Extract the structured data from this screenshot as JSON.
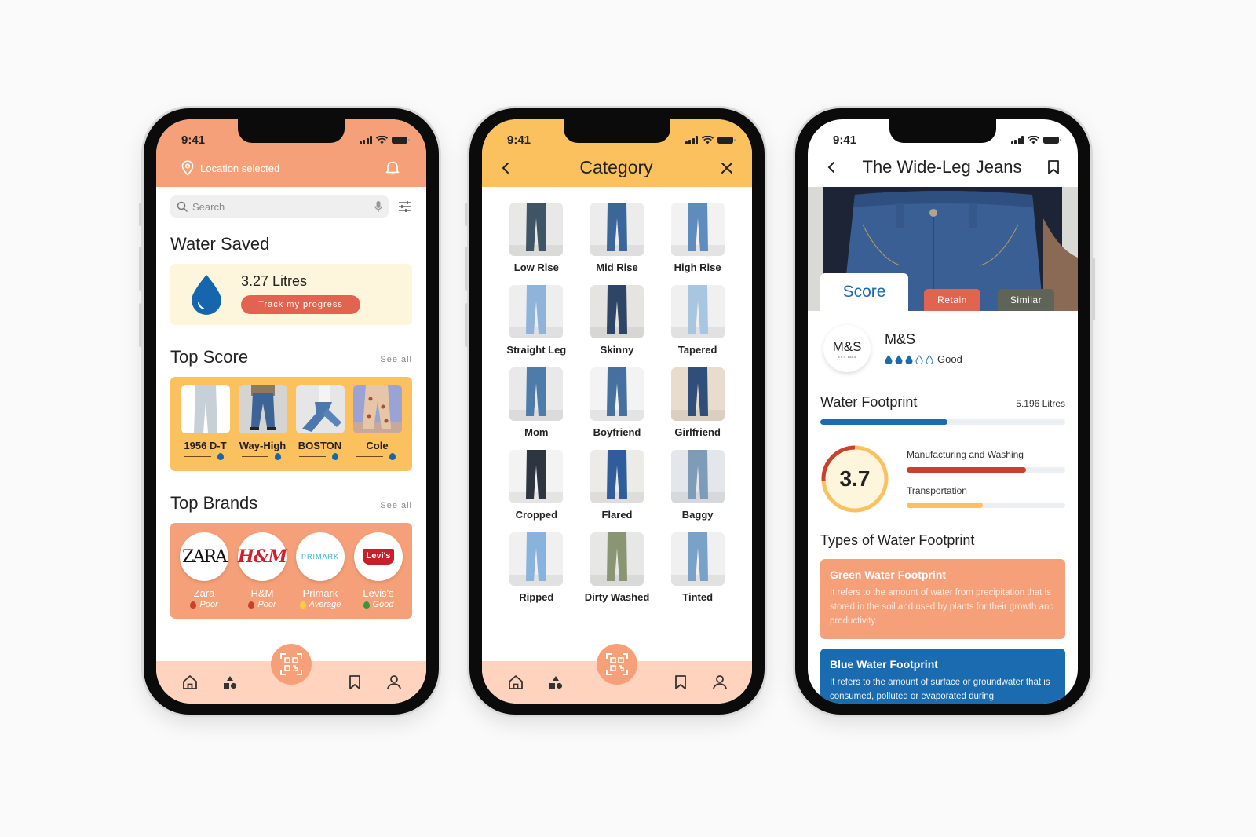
{
  "status_bar": {
    "time": "9:41"
  },
  "colors": {
    "orange": "#f5a078",
    "peach": "#ffd3bd",
    "yellow": "#fbc15e",
    "cream": "#fdf5dc",
    "red": "#e2634f",
    "blue": "#1a6bb0",
    "dark_red": "#c9402b",
    "olive": "#5f6459"
  },
  "home": {
    "location_label": "Location selected",
    "search_placeholder": "Search",
    "water_saved": {
      "title": "Water Saved",
      "amount": "3.27 Litres",
      "button": "Track my progress"
    },
    "top_score": {
      "title": "Top Score",
      "see_all": "See all",
      "items": [
        {
          "name": "1956 D-T"
        },
        {
          "name": "Way-High"
        },
        {
          "name": "BOSTON"
        },
        {
          "name": "Cole"
        }
      ]
    },
    "top_brands": {
      "title": "Top Brands",
      "see_all": "See all",
      "items": [
        {
          "logo": "ZARA",
          "name": "Zara",
          "rating": "Poor",
          "rating_color": "#c9402b"
        },
        {
          "logo": "H&M",
          "name": "H&M",
          "rating": "Poor",
          "rating_color": "#c9402b"
        },
        {
          "logo": "PRIMARK",
          "name": "Primark",
          "rating": "Average",
          "rating_color": "#f5d03c"
        },
        {
          "logo": "Levi's",
          "name": "Levis's",
          "rating": "Good",
          "rating_color": "#2f9a3a"
        }
      ]
    }
  },
  "category": {
    "title": "Category",
    "items": [
      {
        "label": "Low Rise"
      },
      {
        "label": "Mid Rise"
      },
      {
        "label": "High Rise"
      },
      {
        "label": "Straight Leg"
      },
      {
        "label": "Skinny"
      },
      {
        "label": "Tapered"
      },
      {
        "label": "Mom"
      },
      {
        "label": "Boyfriend"
      },
      {
        "label": "Girlfriend"
      },
      {
        "label": "Cropped"
      },
      {
        "label": "Flared"
      },
      {
        "label": "Baggy"
      },
      {
        "label": "Ripped"
      },
      {
        "label": "Dirty Washed"
      },
      {
        "label": "Tinted"
      }
    ]
  },
  "detail": {
    "title": "The Wide-Leg Jeans",
    "tabs": {
      "score": "Score",
      "retain": "Retain",
      "similar": "Similar"
    },
    "brand": {
      "logo": "M&S",
      "logo_sub": "EST. 1884",
      "name": "M&S",
      "rating_label": "Good",
      "rating_filled": 3,
      "rating_max": 5
    },
    "water_footprint": {
      "title": "Water Footprint",
      "value": "5.196 Litres",
      "progress": 0.52
    },
    "score": {
      "value": "3.7",
      "breakdown": [
        {
          "label": "Manufacturing and Washing",
          "progress": 0.75,
          "color": "#c9402b"
        },
        {
          "label": "Transportation",
          "progress": 0.48,
          "color": "#fbc15e"
        }
      ]
    },
    "types": {
      "title": "Types of Water Footprint",
      "cards": [
        {
          "title": "Green Water Footprint",
          "text": "It refers to the amount of water from precipitation that is stored in the soil and used by plants for their growth and productivity."
        },
        {
          "title": "Blue Water Footprint",
          "text": "It refers to the amount of surface or groundwater that is consumed, polluted or evaporated during"
        }
      ]
    }
  }
}
